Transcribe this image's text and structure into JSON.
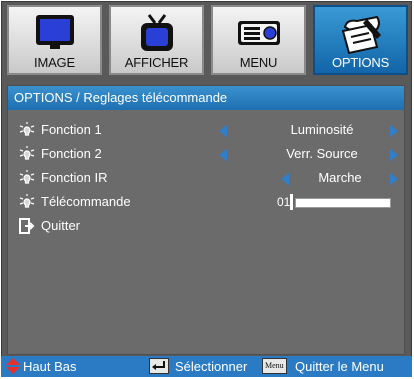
{
  "tabs": [
    {
      "label": "IMAGE",
      "icon": "monitor-icon",
      "active": false
    },
    {
      "label": "AFFICHER",
      "icon": "tv-icon",
      "active": false
    },
    {
      "label": "MENU",
      "icon": "projector-icon",
      "active": false
    },
    {
      "label": "OPTIONS",
      "icon": "options-icon",
      "active": true
    }
  ],
  "panel": {
    "title": "OPTIONS / Reglages télécommande",
    "rows": [
      {
        "label": "Fonction 1",
        "value": "Luminosité"
      },
      {
        "label": "Fonction 2",
        "value": "Verr. Source"
      },
      {
        "label": "Fonction IR",
        "value": "Marche"
      },
      {
        "label": "Télécommande",
        "value": "01",
        "slider_level": 0.01
      },
      {
        "label": "Quitter"
      }
    ]
  },
  "status": {
    "nav_label": "Haut Bas",
    "select_label": "Sélectionner",
    "menu_key": "Menu",
    "exit_label": "Quitter le Menu"
  },
  "colors": {
    "accent": "#2b7bc4",
    "panel_bg": "#6b6b6b",
    "arrow": "#2f7fcc",
    "nav_up_down": "#e53030"
  }
}
